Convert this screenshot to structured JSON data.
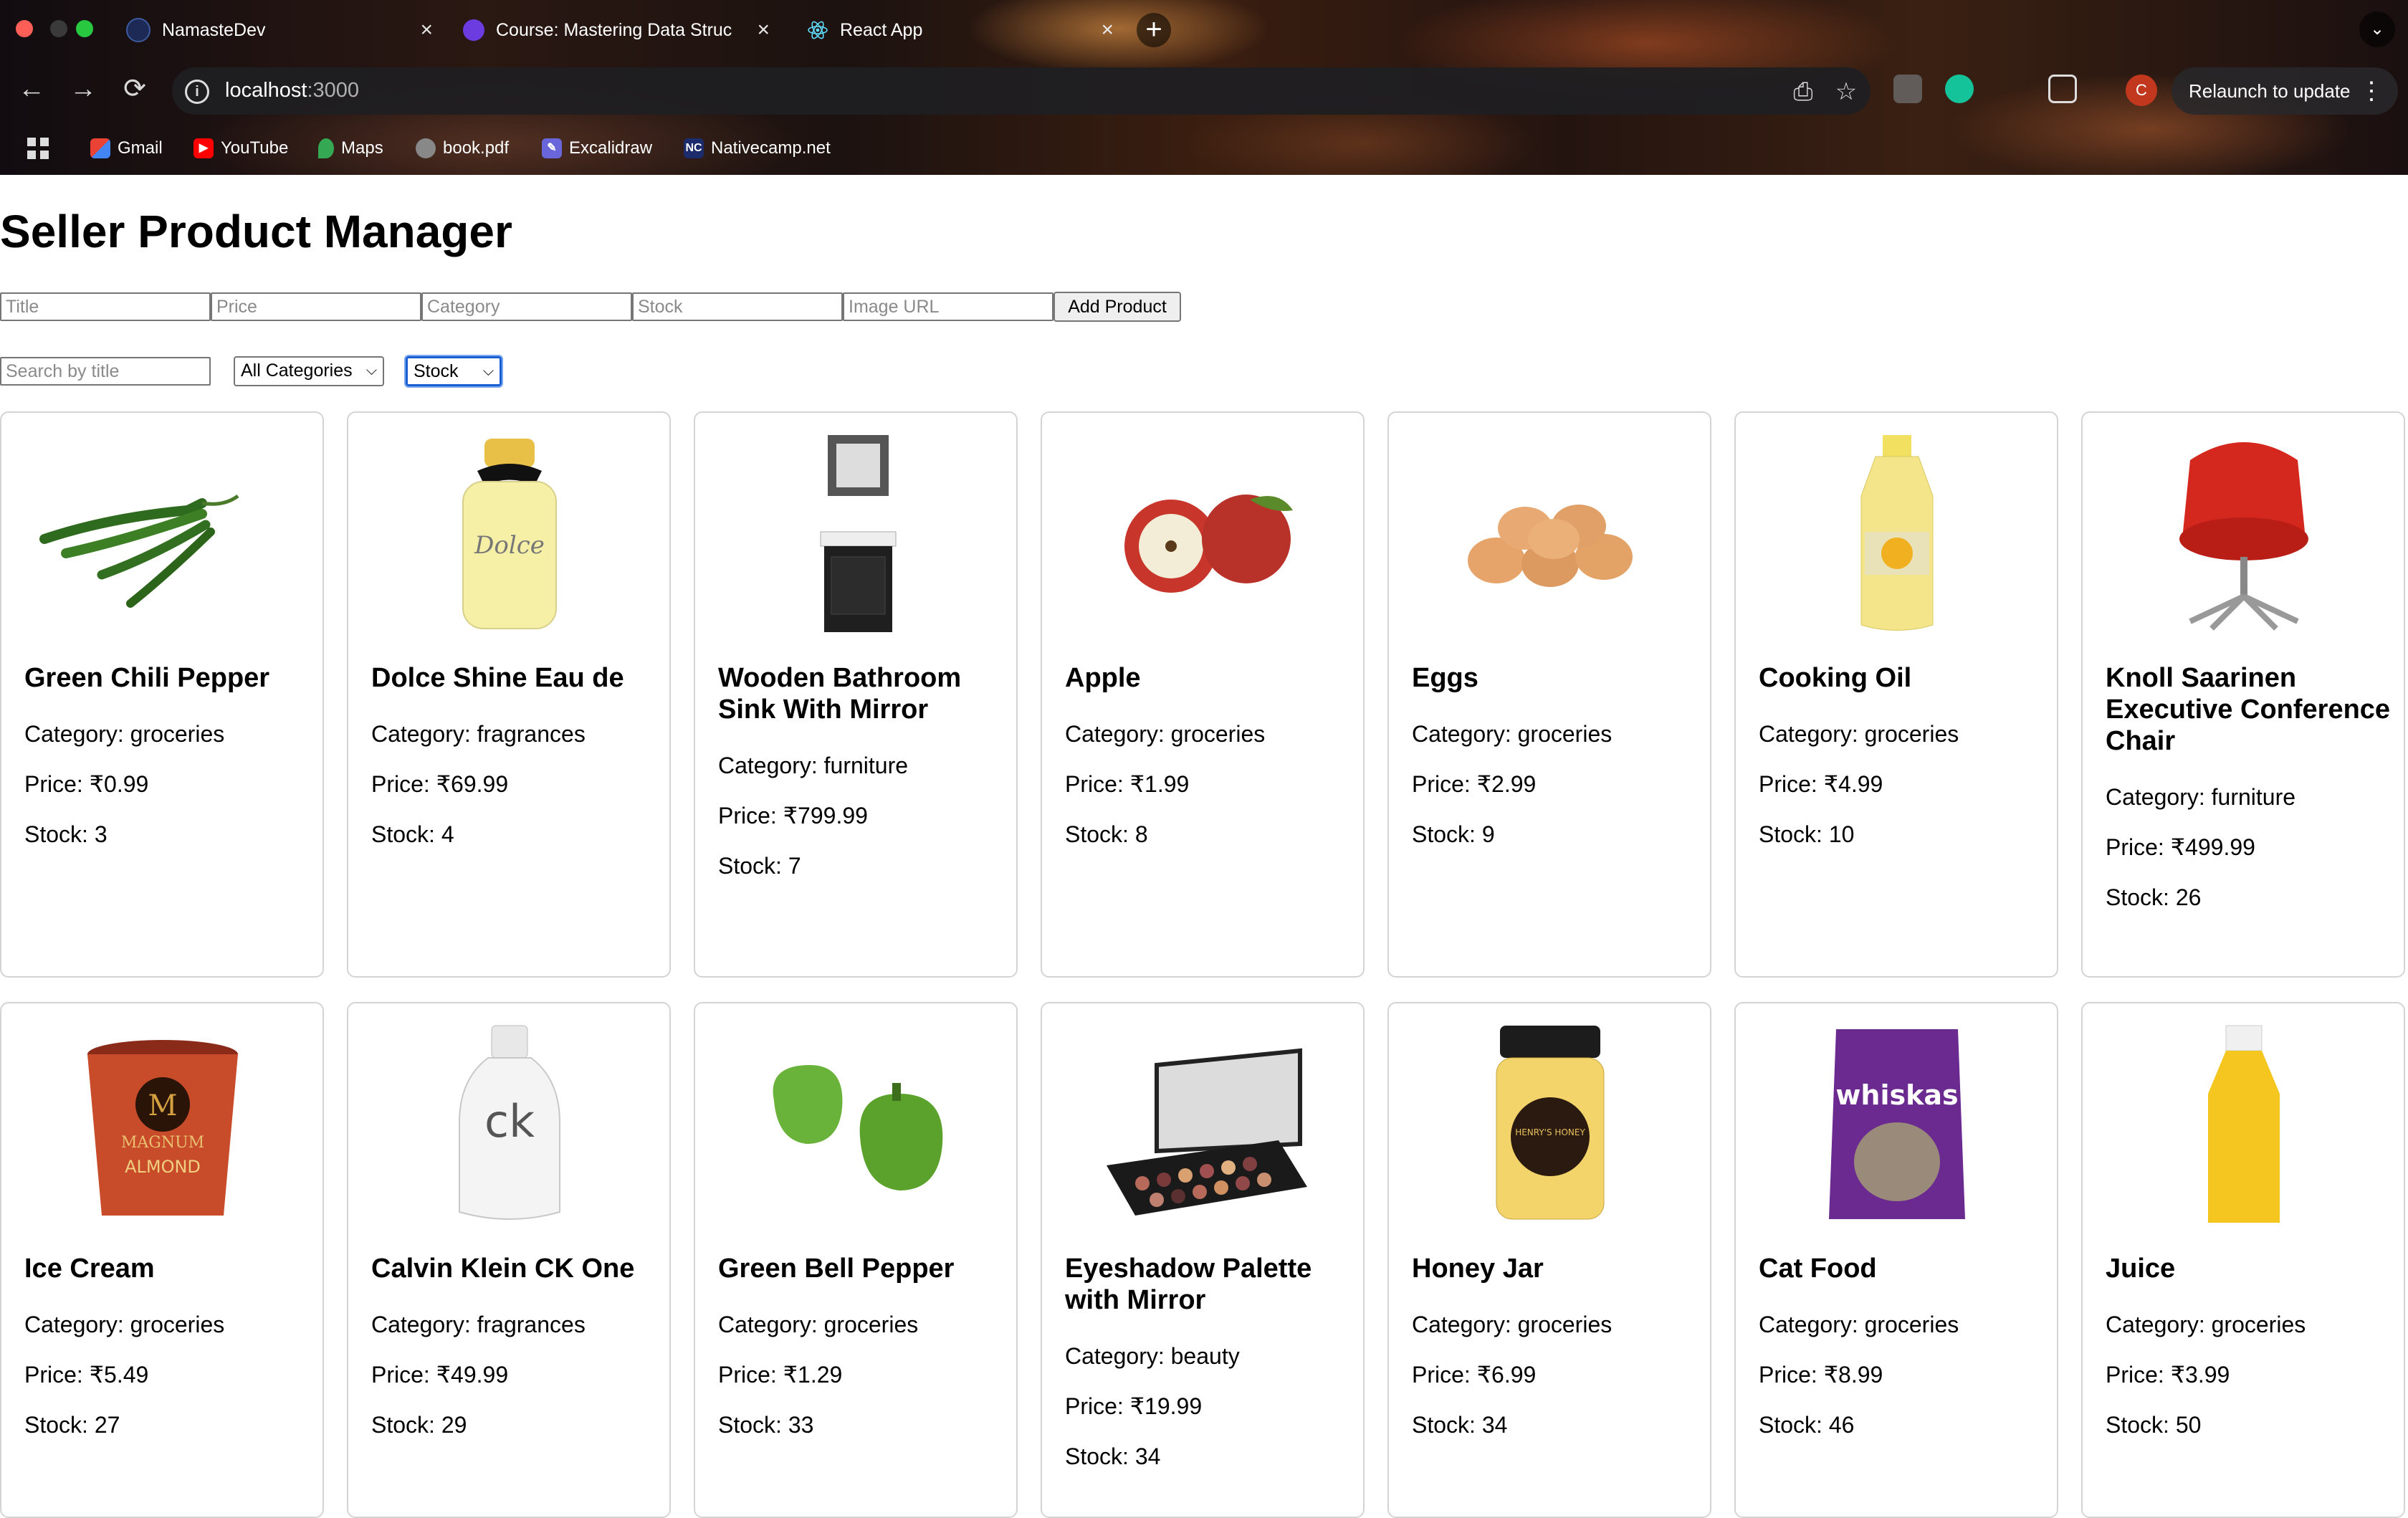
{
  "browser": {
    "tabs": [
      {
        "title": "NamasteDev"
      },
      {
        "title": "Course: Mastering Data Struc"
      },
      {
        "title": "React App"
      }
    ],
    "new_tab": "+",
    "address": {
      "host": "localhost",
      "port": ":3000"
    },
    "relaunch": "Relaunch to update",
    "avatar_initial": "C",
    "bookmarks": [
      {
        "label": "Gmail"
      },
      {
        "label": "YouTube"
      },
      {
        "label": "Maps"
      },
      {
        "label": "book.pdf"
      },
      {
        "label": "Excalidraw"
      },
      {
        "label": "Nativecamp.net",
        "badge": "NC"
      }
    ]
  },
  "page": {
    "title": "Seller Product Manager",
    "form": {
      "title_placeholder": "Title",
      "price_placeholder": "Price",
      "category_placeholder": "Category",
      "stock_placeholder": "Stock",
      "image_placeholder": "Image URL",
      "add_button": "Add Product"
    },
    "filters": {
      "search_placeholder": "Search by title",
      "category_selected": "All Categories",
      "sort_selected": "Stock"
    },
    "labels": {
      "category": "Category: ",
      "price": "Price: ₹",
      "stock": "Stock: "
    },
    "products": [
      {
        "name": "Green Chili Pepper",
        "category": "groceries",
        "price": "0.99",
        "stock": "3",
        "icon": "chili-pepper"
      },
      {
        "name": "Dolce Shine Eau de",
        "category": "fragrances",
        "price": "69.99",
        "stock": "4",
        "icon": "perfume-bottle"
      },
      {
        "name": "Wooden Bathroom Sink With Mirror",
        "category": "furniture",
        "price": "799.99",
        "stock": "7",
        "icon": "bathroom-sink"
      },
      {
        "name": "Apple",
        "category": "groceries",
        "price": "1.99",
        "stock": "8",
        "icon": "apple"
      },
      {
        "name": "Eggs",
        "category": "groceries",
        "price": "2.99",
        "stock": "9",
        "icon": "eggs"
      },
      {
        "name": "Cooking Oil",
        "category": "groceries",
        "price": "4.99",
        "stock": "10",
        "icon": "oil-bottle"
      },
      {
        "name": "Knoll Saarinen Executive Conference Chair",
        "category": "furniture",
        "price": "499.99",
        "stock": "26",
        "icon": "office-chair"
      },
      {
        "name": "Ice Cream",
        "category": "groceries",
        "price": "5.49",
        "stock": "27",
        "icon": "ice-cream-tub"
      },
      {
        "name": "Calvin Klein CK One",
        "category": "fragrances",
        "price": "49.99",
        "stock": "29",
        "icon": "ck-bottle"
      },
      {
        "name": "Green Bell Pepper",
        "category": "groceries",
        "price": "1.29",
        "stock": "33",
        "icon": "bell-pepper"
      },
      {
        "name": "Eyeshadow Palette with Mirror",
        "category": "beauty",
        "price": "19.99",
        "stock": "34",
        "icon": "eyeshadow-palette"
      },
      {
        "name": "Honey Jar",
        "category": "groceries",
        "price": "6.99",
        "stock": "34",
        "icon": "honey-jar"
      },
      {
        "name": "Cat Food",
        "category": "groceries",
        "price": "8.99",
        "stock": "46",
        "icon": "cat-food-pouch"
      },
      {
        "name": "Juice",
        "category": "groceries",
        "price": "3.99",
        "stock": "50",
        "icon": "juice-bottle"
      }
    ],
    "image_text": {
      "ice_cream_brand": "MAGNUM",
      "ice_cream_flavor": "ALMOND",
      "ck_logo": "ck",
      "honey_label": "HENRY'S HONEY",
      "catfood_brand": "whiskas"
    }
  },
  "colors": {
    "focus": "#1a5fd1",
    "avatar": "#c2381f",
    "card_border": "#d4d4d4"
  }
}
